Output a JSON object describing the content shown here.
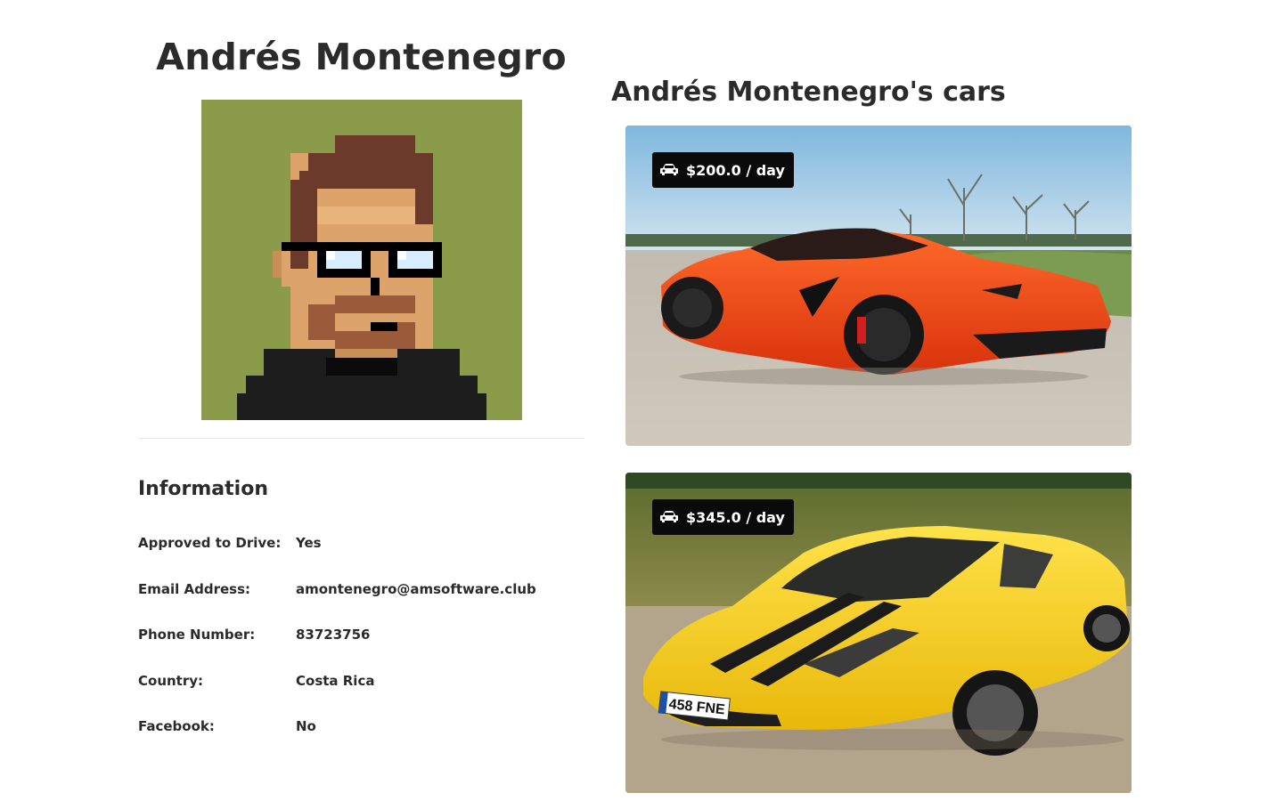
{
  "profile": {
    "name": "Andrés Montenegro",
    "avatar": {
      "background": "#8a9c4a",
      "hair": "#6b3a2a",
      "skin": "#dca46a",
      "shirt": "#1d1d1d"
    }
  },
  "information": {
    "title": "Information",
    "rows": [
      {
        "label": "Approved to Drive:",
        "value": "Yes"
      },
      {
        "label": "Email Address:",
        "value": "amontenegro@amsoftware.club"
      },
      {
        "label": "Phone Number:",
        "value": "83723756"
      },
      {
        "label": "Country:",
        "value": "Costa Rica"
      },
      {
        "label": "Facebook:",
        "value": "No"
      }
    ]
  },
  "cars": {
    "title": "Andrés Montenegro's cars",
    "items": [
      {
        "price": "$200.0 / day",
        "icon": "car-icon",
        "color": "#f04a16"
      },
      {
        "price": "$345.0 / day",
        "icon": "car-icon",
        "color": "#f5c814",
        "plate": "458 FNE"
      }
    ]
  }
}
